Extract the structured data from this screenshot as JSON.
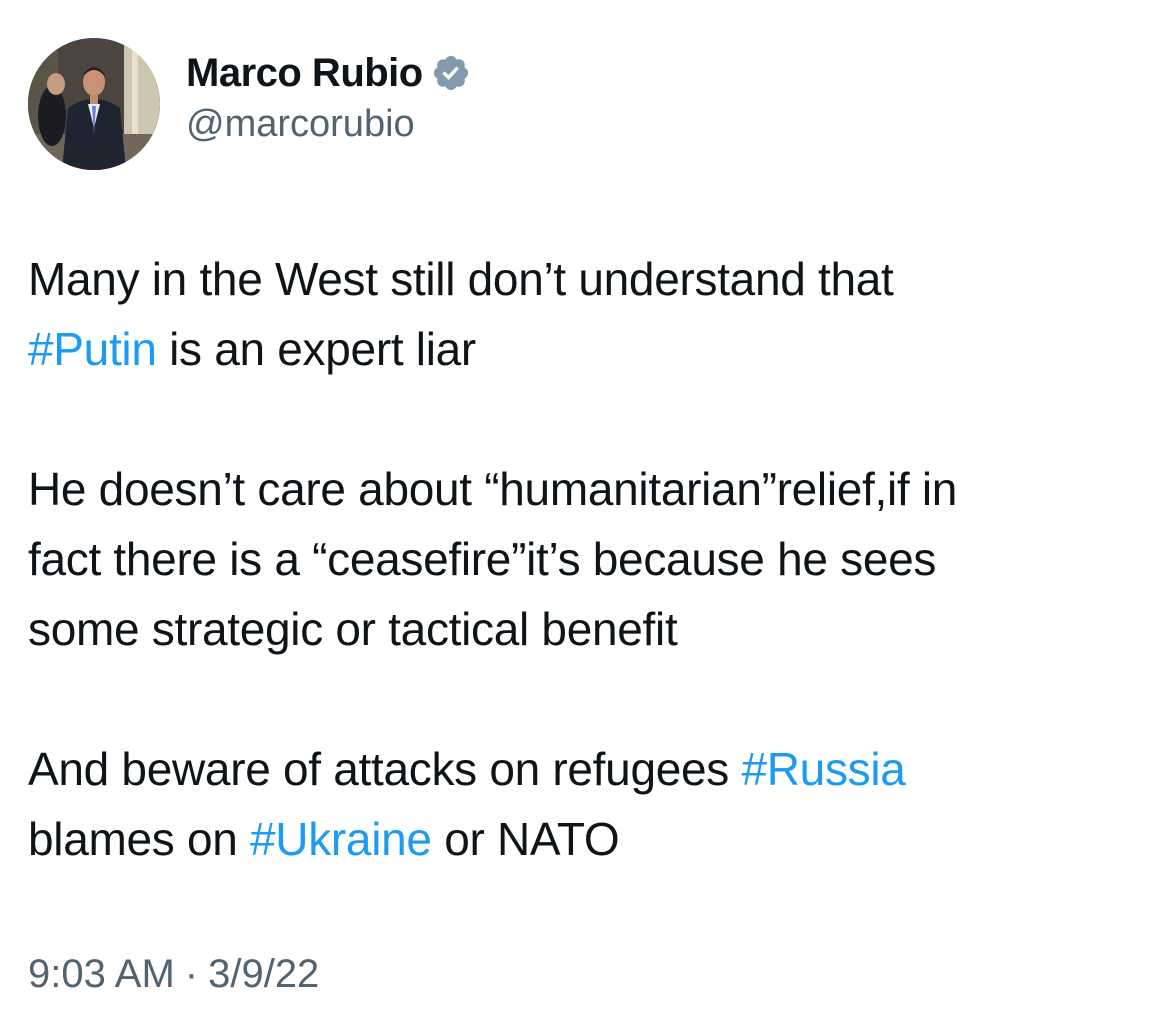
{
  "author": {
    "display_name": "Marco Rubio",
    "handle": "@marcorubio",
    "verified_icon": "verified-badge-icon",
    "verified_color": "#829aab"
  },
  "tweet": {
    "paragraphs": [
      {
        "lines": [
          [
            {
              "text": "Many in the West still don’t understand that",
              "hashtag": false
            }
          ],
          [
            {
              "text": "#Putin",
              "hashtag": true
            },
            {
              "text": " is an expert liar",
              "hashtag": false
            }
          ]
        ]
      },
      {
        "lines": [
          [
            {
              "text": "He doesn’t care about “humanitarian”relief,if in",
              "hashtag": false
            }
          ],
          [
            {
              "text": "fact there is a “ceasefire”it’s because he sees",
              "hashtag": false
            }
          ],
          [
            {
              "text": "some strategic or tactical benefit",
              "hashtag": false
            }
          ]
        ]
      },
      {
        "lines": [
          [
            {
              "text": "And beware of attacks on refugees ",
              "hashtag": false
            },
            {
              "text": "#Russia",
              "hashtag": true
            }
          ],
          [
            {
              "text": "blames on ",
              "hashtag": false
            },
            {
              "text": "#Ukraine",
              "hashtag": true
            },
            {
              "text": " or NATO",
              "hashtag": false
            }
          ]
        ]
      }
    ],
    "time": "9:03 AM",
    "separator": "·",
    "date": "3/9/22"
  },
  "colors": {
    "text": "#0f1419",
    "secondary": "#536471",
    "link": "#1d9bf0"
  }
}
